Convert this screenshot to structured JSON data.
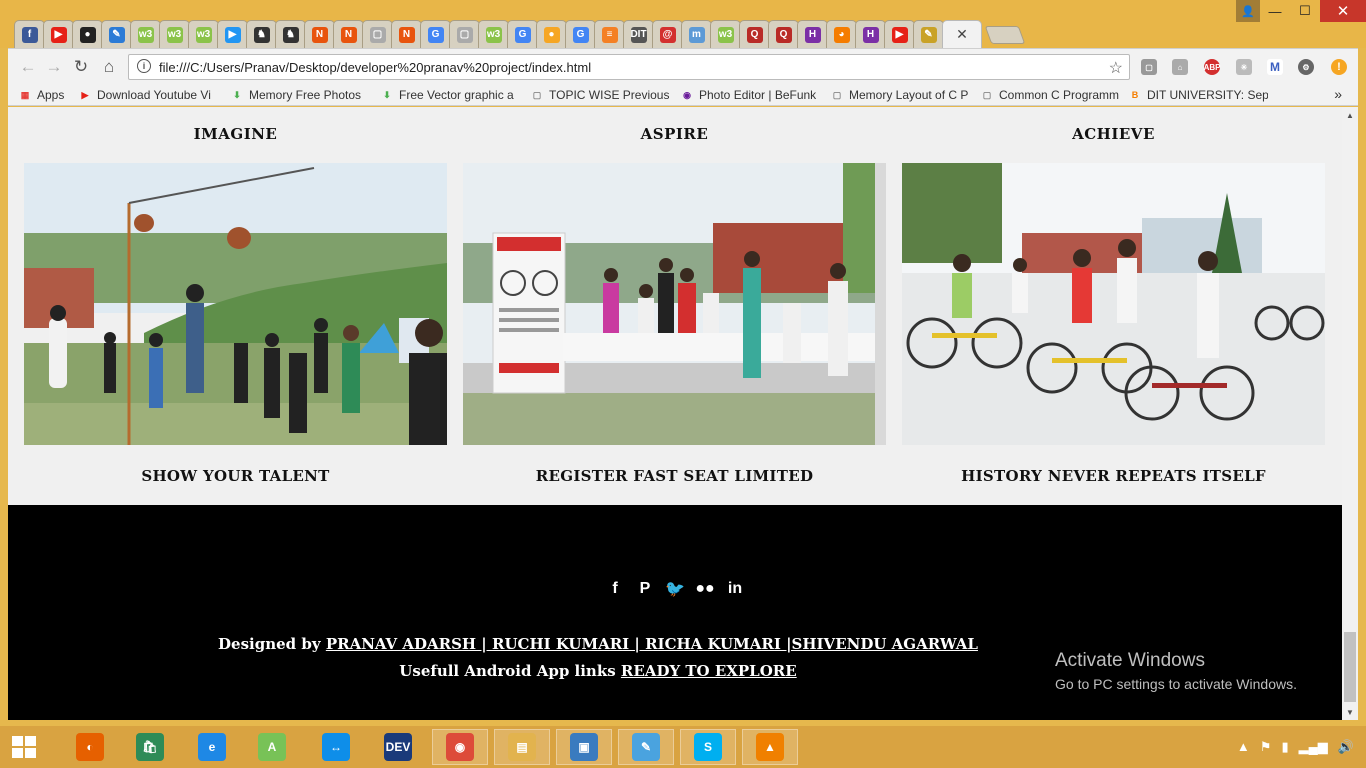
{
  "browser": {
    "tabs": [
      {
        "icon": "facebook-icon",
        "glyph": "f",
        "color": "#3b5998"
      },
      {
        "icon": "youtube-icon",
        "glyph": "▶",
        "color": "#e62117"
      },
      {
        "icon": "github-icon",
        "glyph": "●",
        "color": "#222"
      },
      {
        "icon": "generic-site-icon",
        "glyph": "✎",
        "color": "#2b7bd6"
      },
      {
        "icon": "w3schools-icon",
        "glyph": "w3",
        "color": "#8bc34a"
      },
      {
        "icon": "w3schools-icon",
        "glyph": "w3",
        "color": "#8bc34a"
      },
      {
        "icon": "w3schools-icon",
        "glyph": "w3",
        "color": "#8bc34a"
      },
      {
        "icon": "play-icon",
        "glyph": "▶",
        "color": "#2196f3"
      },
      {
        "icon": "bat-icon",
        "glyph": "♞",
        "color": "#333"
      },
      {
        "icon": "bat-icon",
        "glyph": "♞",
        "color": "#333"
      },
      {
        "icon": "n-logo-icon",
        "glyph": "N",
        "color": "#e8540d"
      },
      {
        "icon": "n-logo-icon",
        "glyph": "N",
        "color": "#e8540d"
      },
      {
        "icon": "page-icon",
        "glyph": "▢",
        "color": "#aaa"
      },
      {
        "icon": "n-logo-icon",
        "glyph": "N",
        "color": "#e8540d"
      },
      {
        "icon": "google-icon",
        "glyph": "G",
        "color": "#4285f4"
      },
      {
        "icon": "page-icon",
        "glyph": "▢",
        "color": "#aaa"
      },
      {
        "icon": "w3schools-icon",
        "glyph": "w3",
        "color": "#8bc34a"
      },
      {
        "icon": "google-icon",
        "glyph": "G",
        "color": "#4285f4"
      },
      {
        "icon": "fruit-icon",
        "glyph": "●",
        "color": "#f6a623"
      },
      {
        "icon": "google-icon",
        "glyph": "G",
        "color": "#4285f4"
      },
      {
        "icon": "stackoverflow-icon",
        "glyph": "≡",
        "color": "#f48024"
      },
      {
        "icon": "dit-icon",
        "glyph": "DIT",
        "color": "#555"
      },
      {
        "icon": "swirl-icon",
        "glyph": "@",
        "color": "#d3302f"
      },
      {
        "icon": "m-logo-icon",
        "glyph": "m",
        "color": "#5c9ad6"
      },
      {
        "icon": "w3schools-icon",
        "glyph": "w3",
        "color": "#8bc34a"
      },
      {
        "icon": "quora-icon",
        "glyph": "Q",
        "color": "#b92b27"
      },
      {
        "icon": "quora-icon",
        "glyph": "Q",
        "color": "#b92b27"
      },
      {
        "icon": "hackerearth-icon",
        "glyph": "H",
        "color": "#7b2fa6"
      },
      {
        "icon": "owl-icon",
        "glyph": "◕",
        "color": "#f57c00"
      },
      {
        "icon": "hackerearth-icon",
        "glyph": "H",
        "color": "#7b2fa6"
      },
      {
        "icon": "youtube-icon",
        "glyph": "▶",
        "color": "#e62117"
      },
      {
        "icon": "pen-icon",
        "glyph": "✎",
        "color": "#c9a227"
      }
    ],
    "active_tab_close": "✕",
    "url": "file:///C:/Users/Pranav/Desktop/developer%20pranav%20project/index.html",
    "bookmarks": [
      {
        "label": "Apps",
        "icon": "apps-grid-icon",
        "color": "#e53935",
        "glyph": "▦"
      },
      {
        "label": "Download Youtube Vi",
        "icon": "youtube-icon",
        "color": "#e62117",
        "glyph": "▶"
      },
      {
        "label": "Memory Free Photos",
        "icon": "freepik-icon",
        "color": "#4caf50",
        "glyph": "⬇"
      },
      {
        "label": "Free Vector graphic a",
        "icon": "freepik-icon",
        "color": "#4caf50",
        "glyph": "⬇"
      },
      {
        "label": "TOPIC WISE Previous",
        "icon": "page-icon",
        "color": "#888",
        "glyph": "▢"
      },
      {
        "label": "Photo Editor | BeFunk",
        "icon": "befunky-icon",
        "color": "#6a1b9a",
        "glyph": "◉"
      },
      {
        "label": "Memory Layout of C P",
        "icon": "page-icon",
        "color": "#888",
        "glyph": "▢"
      },
      {
        "label": "Common C Programm",
        "icon": "page-icon",
        "color": "#888",
        "glyph": "▢"
      },
      {
        "label": "DIT UNIVERSITY: Sept",
        "icon": "blogger-icon",
        "color": "#f57d00",
        "glyph": "B"
      }
    ],
    "more_bookmarks": "»",
    "accent": "#e8b648"
  },
  "page": {
    "headings": [
      "IMAGINE",
      "ASPIRE",
      "ACHIEVE"
    ],
    "captions": [
      "SHOW YOUR TALENT",
      "REGISTER FAST SEAT LIMITED",
      "HISTORY NEVER REPEATS ITSELF"
    ],
    "photos": [
      "matka-phod-game-photo",
      "bicycle-registration-desk-photo",
      "cycle-race-photo"
    ],
    "footer": {
      "social": [
        {
          "icon": "facebook-icon",
          "glyph": "f"
        },
        {
          "icon": "pinterest-icon",
          "glyph": "P"
        },
        {
          "icon": "twitter-icon",
          "glyph": "🐦"
        },
        {
          "icon": "flickr-icon",
          "glyph": "●●"
        },
        {
          "icon": "linkedin-icon",
          "glyph": "in"
        }
      ],
      "designed_by": "Designed by",
      "authors": "PRANAV ADARSH | RUCHI KUMARI | RICHA KUMARI |SHIVENDU AGARWAL",
      "useful_links": "Usefull Android App links",
      "explore_link": "READY TO EXPLORE"
    },
    "watermark": {
      "title": "Activate Windows",
      "subtitle": "Go to PC settings to activate Windows."
    }
  },
  "taskbar": {
    "apps": [
      {
        "icon": "firefox-icon",
        "glyph": "◐",
        "color": "#e66000"
      },
      {
        "icon": "windows-store-icon",
        "glyph": "🛍",
        "color": "#2e8b57"
      },
      {
        "icon": "internet-explorer-icon",
        "glyph": "e",
        "color": "#1e88e5"
      },
      {
        "icon": "android-studio-icon",
        "glyph": "A",
        "color": "#78c257"
      },
      {
        "icon": "teamviewer-icon",
        "glyph": "↔",
        "color": "#0e8ee9"
      },
      {
        "icon": "devcpp-icon",
        "glyph": "DEV",
        "color": "#1a3a7a"
      },
      {
        "icon": "chrome-icon",
        "glyph": "◉",
        "color": "#dd4b39"
      },
      {
        "icon": "file-explorer-icon",
        "glyph": "▤",
        "color": "#e2b34e"
      },
      {
        "icon": "photos-icon",
        "glyph": "▣",
        "color": "#3a7bbf"
      },
      {
        "icon": "notepad-icon",
        "glyph": "✎",
        "color": "#4aa3df"
      },
      {
        "icon": "skype-icon",
        "glyph": "S",
        "color": "#00aff0"
      },
      {
        "icon": "vlc-icon",
        "glyph": "▲",
        "color": "#f08000"
      }
    ],
    "tray": [
      "▲",
      "⚑",
      "▮",
      "▂▄▆",
      "🔊"
    ]
  }
}
